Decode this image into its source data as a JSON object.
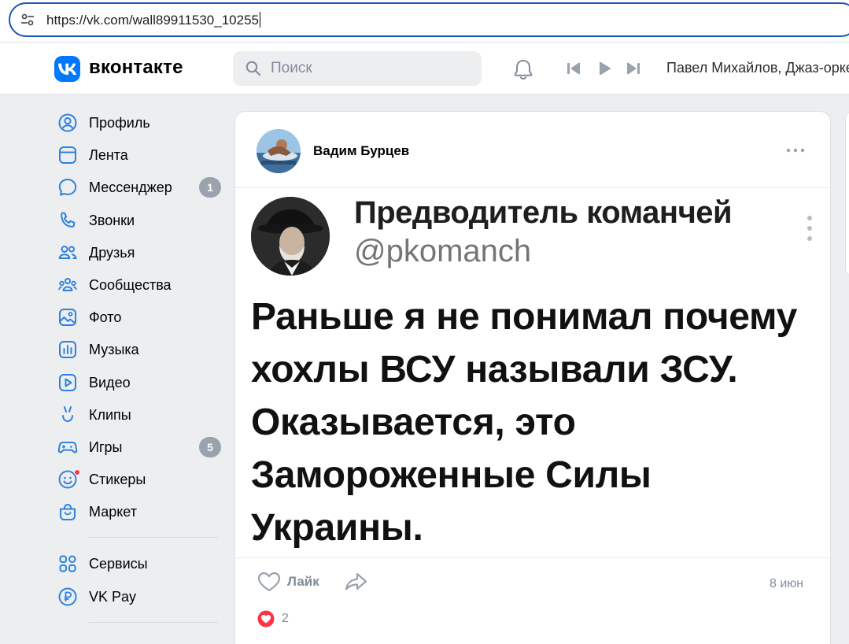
{
  "browser": {
    "url": "https://vk.com/wall89911530_10255"
  },
  "header": {
    "brand": "вконтакте",
    "search_placeholder": "Поиск",
    "now_playing": "Павел Михайлов, Джаз-оркестр"
  },
  "sidebar": {
    "items": [
      {
        "label": "Профиль",
        "icon": "profile-icon"
      },
      {
        "label": "Лента",
        "icon": "feed-icon"
      },
      {
        "label": "Мессенджер",
        "icon": "messenger-icon",
        "badge": "1"
      },
      {
        "label": "Звонки",
        "icon": "phone-icon"
      },
      {
        "label": "Друзья",
        "icon": "friends-icon"
      },
      {
        "label": "Сообщества",
        "icon": "communities-icon"
      },
      {
        "label": "Фото",
        "icon": "photo-icon"
      },
      {
        "label": "Музыка",
        "icon": "music-icon"
      },
      {
        "label": "Видео",
        "icon": "video-icon"
      },
      {
        "label": "Клипы",
        "icon": "clips-icon"
      },
      {
        "label": "Игры",
        "icon": "games-icon",
        "badge": "5"
      },
      {
        "label": "Стикеры",
        "icon": "stickers-icon"
      },
      {
        "label": "Маркет",
        "icon": "market-icon"
      }
    ],
    "secondary": [
      {
        "label": "Сервисы",
        "icon": "services-icon"
      },
      {
        "label": "VK Pay",
        "icon": "vkpay-icon"
      }
    ]
  },
  "post": {
    "author": "Вадим Бурцев",
    "tweet": {
      "name": "Предводитель команчей",
      "handle": "@pkomanch",
      "text": "Раньше я не понимал почему хохлы ВСУ называли ЗСУ. Оказывается, это Замороженные Силы Украины."
    },
    "like_label": "Лайк",
    "date": "8 июн",
    "reaction_count": "2"
  },
  "colors": {
    "accent": "#0077ff",
    "background": "#edeef0",
    "muted": "#818c99",
    "reaction": "#ff3347"
  }
}
